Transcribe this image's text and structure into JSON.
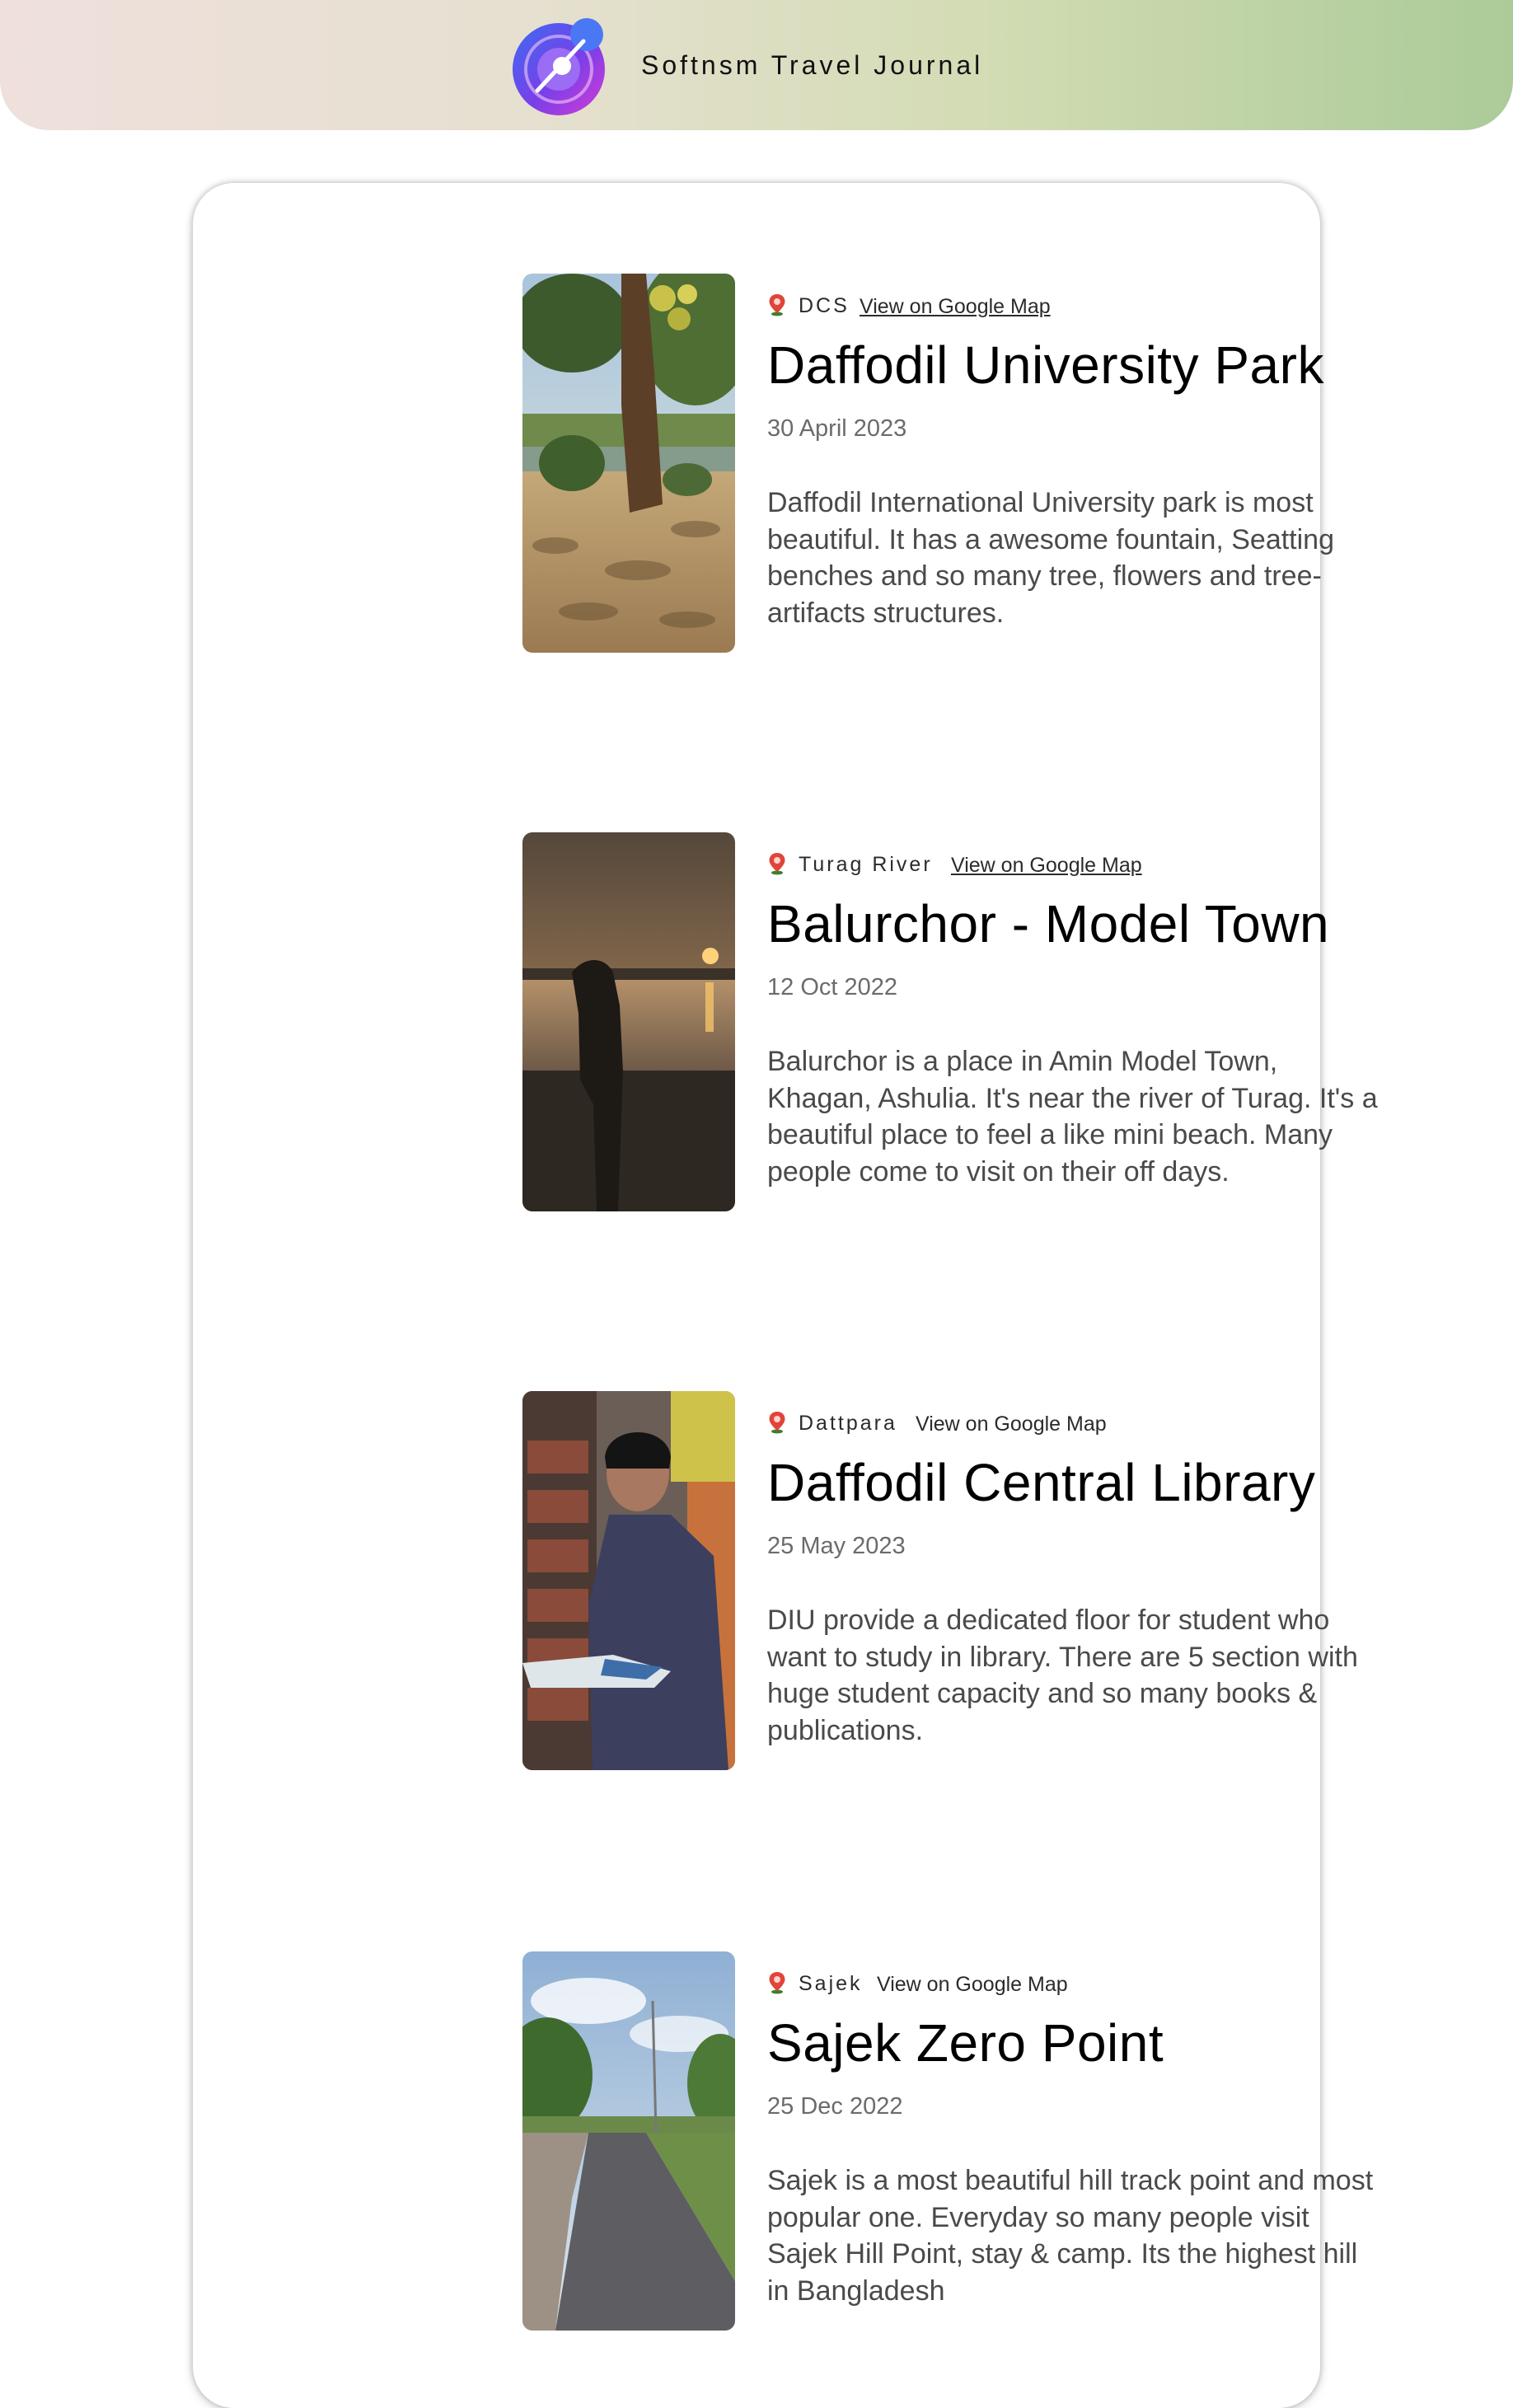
{
  "header": {
    "brand": "Softnsm Travel Journal",
    "logo_icon": "journal-logo-icon",
    "gradient": [
      "#efe0dc",
      "#d3dcb4",
      "#abcb98"
    ]
  },
  "entries": [
    {
      "location": "DCS",
      "map_link": "View on Google Map",
      "title": "Daffodil University Park",
      "date": "30 April 2023",
      "description": "Daffodil International University park is most beautiful. It has a awesome fountain, Seatting benches and so many tree, flowers and tree-artifacts structures."
    },
    {
      "location": "Turag River",
      "map_link": "View on Google Map",
      "title": "Balurchor - Model Town",
      "date": "12 Oct 2022",
      "description": "Balurchor is a place in Amin Model Town, Khagan, Ashulia. It's near the river of Turag. It's a beautiful place to feel a like mini beach. Many people come to visit on their off days."
    },
    {
      "location": "Dattpara",
      "map_link": "View on Google Map",
      "title": "Daffodil Central Library",
      "date": "25 May 2023",
      "description": "DIU provide a dedicated floor for student who want to study in library. There are 5 section with huge student capacity and so many books & publications."
    },
    {
      "location": "Sajek",
      "map_link": "View on Google Map",
      "title": "Sajek Zero Point",
      "date": "25 Dec 2022",
      "description": "Sajek is a most beautiful hill track point and most popular one. Everyday so many people visit Sajek Hill Point, stay & camp. Its the highest hill in Bangladesh"
    }
  ],
  "icons": {
    "location": "map-pin-icon"
  }
}
